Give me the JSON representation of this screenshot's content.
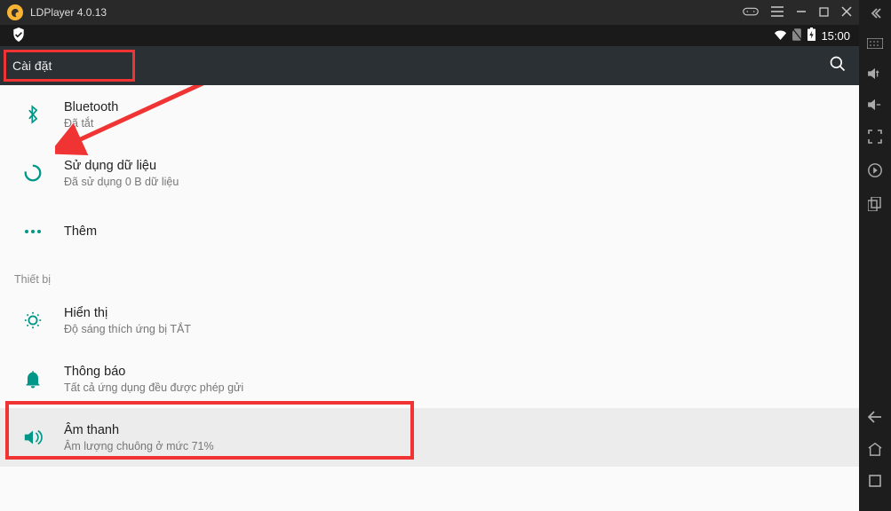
{
  "app": {
    "title": "LDPlayer 4.0.13"
  },
  "status": {
    "time": "15:00"
  },
  "header": {
    "title": "Cài đặt"
  },
  "section": {
    "device": "Thiết bị"
  },
  "rows": {
    "bluetooth": {
      "title": "Bluetooth",
      "sub": "Đã tắt"
    },
    "data": {
      "title": "Sử dụng dữ liệu",
      "sub": "Đã sử dụng 0 B dữ liệu"
    },
    "more": {
      "title": "Thêm"
    },
    "display": {
      "title": "Hiển thị",
      "sub": "Độ sáng thích ứng bị TẮT"
    },
    "notif": {
      "title": "Thông báo",
      "sub": "Tất cả ứng dụng đều được phép gửi"
    },
    "sound": {
      "title": "Âm thanh",
      "sub": "Âm lượng chuông ở mức 71%"
    }
  }
}
